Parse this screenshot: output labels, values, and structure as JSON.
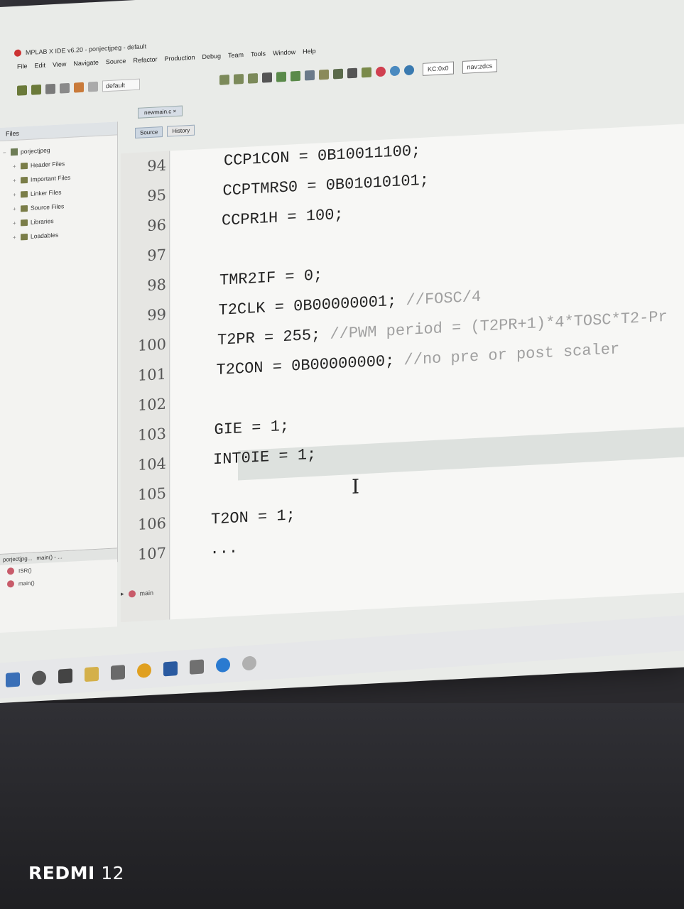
{
  "window": {
    "title": "MPLAB X IDE v6.20 - ponjectjpeg - default"
  },
  "menu": [
    "File",
    "Edit",
    "View",
    "Navigate",
    "Source",
    "Refactor",
    "Production",
    "Debug",
    "Team",
    "Tools",
    "Window",
    "Help"
  ],
  "toolbar": {
    "config": "default",
    "search": "KC:0x0",
    "search2": "nav:zdcs"
  },
  "left_panel": {
    "tab": "Files",
    "project": "porjectjpeg",
    "folders": [
      "Header Files",
      "Important Files",
      "Linker Files",
      "Source Files",
      "Libraries",
      "Loadables"
    ]
  },
  "navigator": {
    "title": "porjectjpg...",
    "member": "main() - ...",
    "items": [
      "ISR()",
      "main()"
    ]
  },
  "editor": {
    "tab": "newmain.c",
    "source_label": "Source",
    "history_label": "History",
    "lines": [
      {
        "num": "94",
        "code": "CCP1CON = 0B10011100;",
        "comment": ""
      },
      {
        "num": "95",
        "code": "CCPTMRS0 = 0B01010101;",
        "comment": ""
      },
      {
        "num": "96",
        "code": "CCPR1H = 100;",
        "comment": ""
      },
      {
        "num": "97",
        "code": "",
        "comment": ""
      },
      {
        "num": "98",
        "code": "TMR2IF = 0;",
        "comment": ""
      },
      {
        "num": "99",
        "code": "T2CLK = 0B00000001; ",
        "comment": "//FOSC/4"
      },
      {
        "num": "100",
        "code": "T2PR = 255; ",
        "comment": "//PWM period = (T2PR+1)*4*TOSC*T2-Pr"
      },
      {
        "num": "101",
        "code": "T2CON = 0B00000000; ",
        "comment": "//no pre or post scaler"
      },
      {
        "num": "102",
        "code": "",
        "comment": ""
      },
      {
        "num": "103",
        "code": "GIE = 1;",
        "comment": ""
      },
      {
        "num": "104",
        "code": "INT0IE = 1;",
        "comment": ""
      },
      {
        "num": "105",
        "code": "",
        "comment": ""
      },
      {
        "num": "106",
        "code": "T2ON = 1;",
        "comment": ""
      },
      {
        "num": "107",
        "code": "...",
        "comment": ""
      }
    ],
    "breadcrumb": [
      "main"
    ]
  },
  "watermark": {
    "brand": "REDMI",
    "model": "12"
  }
}
